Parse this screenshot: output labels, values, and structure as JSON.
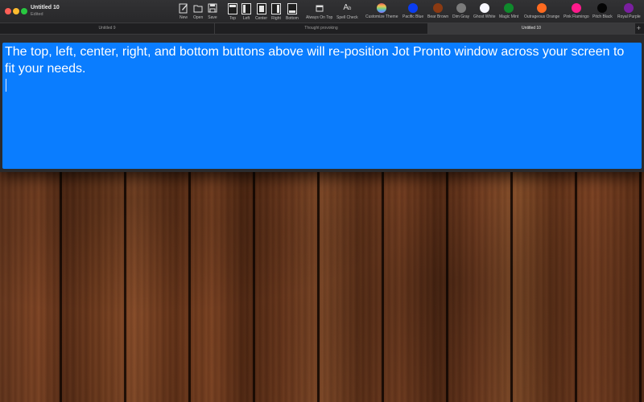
{
  "window": {
    "title": "Untitled 10",
    "subtitle": "Edited"
  },
  "toolbar": {
    "buttons": [
      {
        "label": "New",
        "icon": "new-note-icon"
      },
      {
        "label": "Open",
        "icon": "folder-icon"
      },
      {
        "label": "Save",
        "icon": "save-icon"
      },
      {
        "label": "Top",
        "icon": "position-top-icon"
      },
      {
        "label": "Left",
        "icon": "position-left-icon"
      },
      {
        "label": "Center",
        "icon": "position-center-icon"
      },
      {
        "label": "Right",
        "icon": "position-right-icon"
      },
      {
        "label": "Bottom",
        "icon": "position-bottom-icon"
      },
      {
        "label": "Always On Top",
        "icon": "always-on-top-icon"
      },
      {
        "label": "Spell Check",
        "icon": "spell-check-icon"
      },
      {
        "label": "Customize Theme",
        "icon": "theme-wheel-icon"
      }
    ],
    "themes": [
      {
        "label": "Pacific Blue",
        "color": "#0a3df0"
      },
      {
        "label": "Bear Brown",
        "color": "#8b3a12"
      },
      {
        "label": "Dim Gray",
        "color": "#7b7b7b"
      },
      {
        "label": "Ghost White",
        "color": "#f8f8ff"
      },
      {
        "label": "Magic Mint",
        "color": "#0f8a2c"
      },
      {
        "label": "Outrageous Orange",
        "color": "#ff6a1f"
      },
      {
        "label": "Pink Flamingo",
        "color": "#ff1a8c"
      },
      {
        "label": "Pitch Black",
        "color": "#050505"
      },
      {
        "label": "Royal Purple",
        "color": "#7a1fa0"
      }
    ]
  },
  "tabs": [
    {
      "label": "Untitled 9",
      "active": false
    },
    {
      "label": "Thought provoking",
      "active": false
    },
    {
      "label": "Untitled 10",
      "active": true
    }
  ],
  "tab_add": "+",
  "editor": {
    "text": "The top, left, center, right, and bottom buttons above will re-position Jot Pronto window across your screen to fit your needs.",
    "background": "#0a7dff"
  }
}
